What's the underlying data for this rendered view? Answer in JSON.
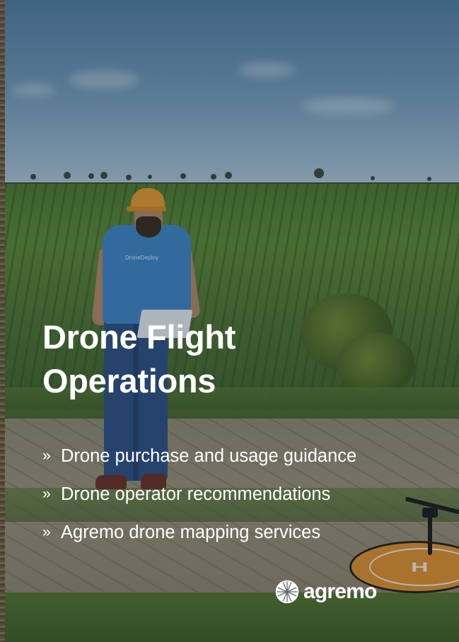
{
  "heading": {
    "line1": "Drone Flight",
    "line2": "Operations"
  },
  "services": [
    {
      "label": "Drone purchase and usage guidance"
    },
    {
      "label": "Drone operator recommendations"
    },
    {
      "label": "Agremo drone mapping services"
    }
  ],
  "bullet_glyph": "»",
  "brand": {
    "name": "agremo",
    "icon": "globe-icon"
  },
  "photo_labels": {
    "shirt": "DroneDeploy",
    "helipad": "H"
  },
  "colors": {
    "text": "#ffffff",
    "helipad": "#e2922f",
    "shirt": "#3f86c9"
  }
}
